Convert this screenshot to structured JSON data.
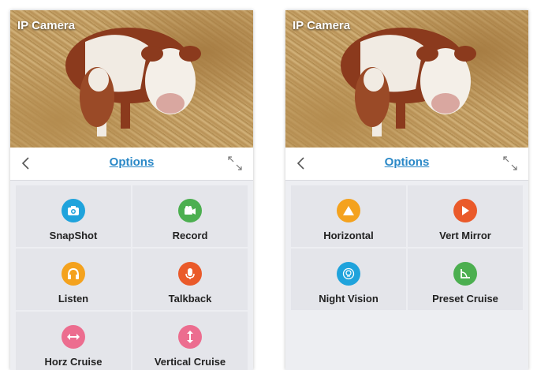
{
  "screens": [
    {
      "camera_title": "IP Camera",
      "nav_title": "Options",
      "options": [
        {
          "label": "SnapShot",
          "icon": "camera-icon",
          "color": "#1fa3dc"
        },
        {
          "label": "Record",
          "icon": "video-camera-icon",
          "color": "#4caf50"
        },
        {
          "label": "Listen",
          "icon": "headphones-icon",
          "color": "#f4a21e"
        },
        {
          "label": "Talkback",
          "icon": "microphone-icon",
          "color": "#ea5a2a"
        },
        {
          "label": "Horz Cruise",
          "icon": "horizontal-arrows-icon",
          "color": "#ec6d8f"
        },
        {
          "label": "Vertical Cruise",
          "icon": "vertical-arrows-icon",
          "color": "#ec6d8f"
        }
      ]
    },
    {
      "camera_title": "IP Camera",
      "nav_title": "Options",
      "options": [
        {
          "label": "Horizontal",
          "icon": "warning-triangle-icon",
          "color": "#f4a21e"
        },
        {
          "label": "Vert Mirror",
          "icon": "play-triangle-icon",
          "color": "#ea5a2a"
        },
        {
          "label": "Night Vision",
          "icon": "bulb-icon",
          "color": "#1fa3dc"
        },
        {
          "label": "Preset Cruise",
          "icon": "chart-corner-icon",
          "color": "#4caf50"
        }
      ]
    }
  ]
}
